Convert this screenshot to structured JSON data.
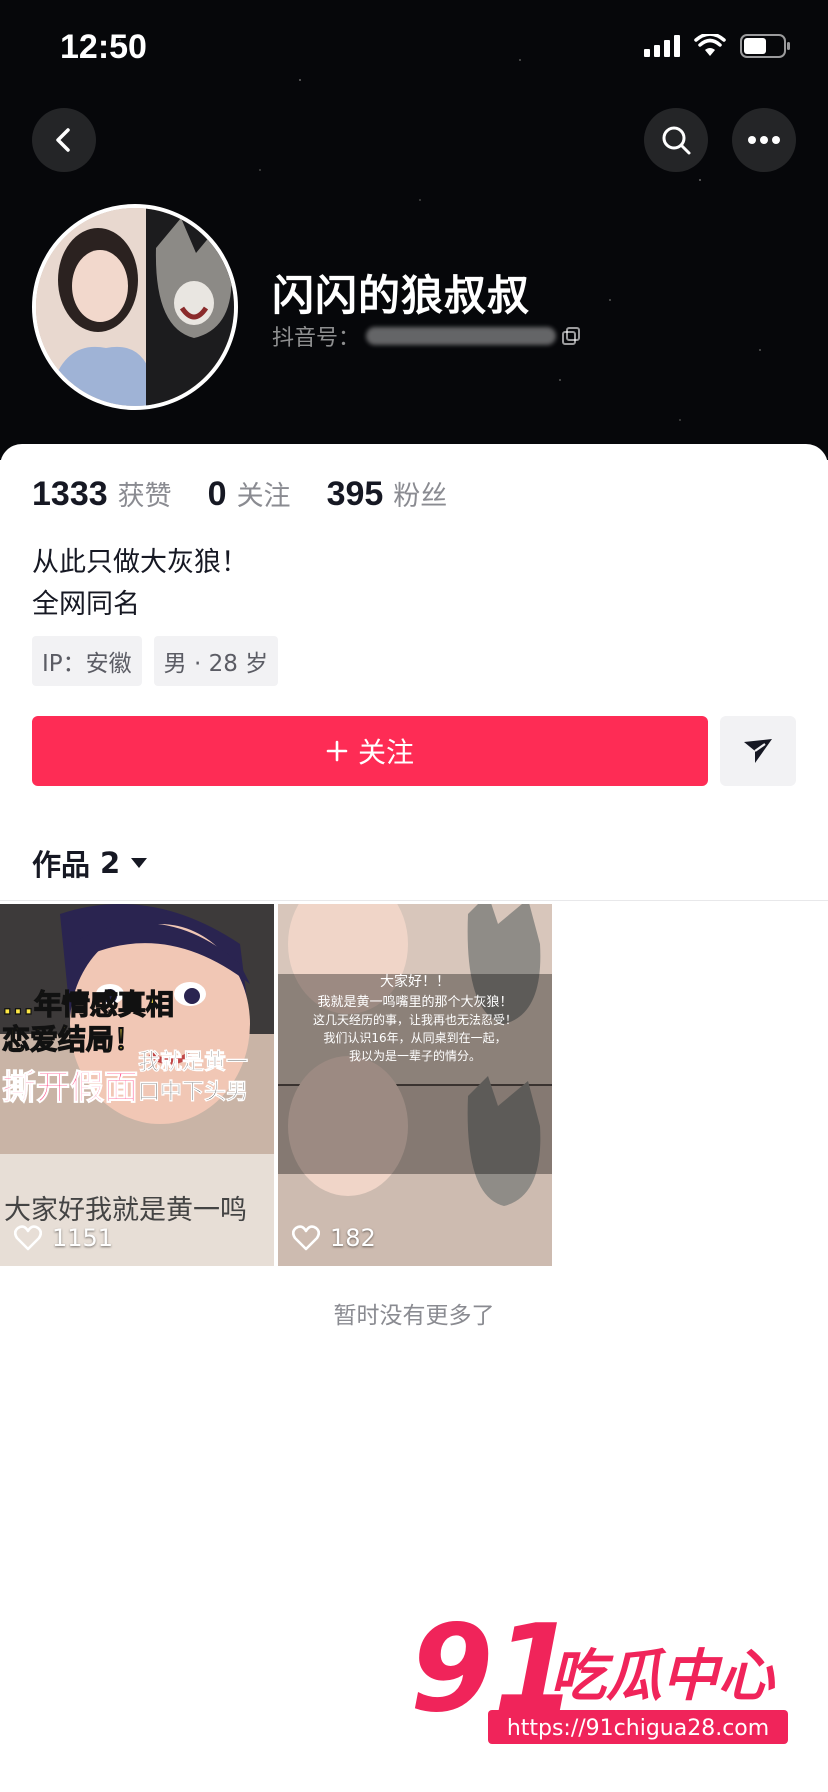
{
  "status_bar": {
    "time": "12:50"
  },
  "profile": {
    "nickname": "闪闪的狼叔叔",
    "id_label": "抖音号："
  },
  "stats": [
    {
      "value": "1333",
      "label": "获赞"
    },
    {
      "value": "0",
      "label": "关注"
    },
    {
      "value": "395",
      "label": "粉丝"
    }
  ],
  "bio": {
    "line1": "从此只做大灰狼！",
    "line2": "全网同名"
  },
  "tags": [
    "IP：安徽",
    "男 · 28 岁"
  ],
  "actions": {
    "follow_label": "关注"
  },
  "works": {
    "tab_label": "作品",
    "count": "2",
    "items": [
      {
        "likes": "1151",
        "caption_lines": [
          "...年情感真相",
          "恋爱结局！",
          "撕开假面",
          "我就是黄一",
          "口中下头男",
          "大家好我就是黄一鸣"
        ]
      },
      {
        "likes": "182",
        "caption_lines": [
          "大家好！！",
          "我就是黄一鸣嘴里的那个大灰狼！",
          "这几天经历的事，让我再也无法忍受！",
          "我们认识16年，从同桌到在一起，",
          "我以为是一辈子的情分。"
        ]
      }
    ],
    "no_more": "暂时没有更多了"
  },
  "watermark": {
    "brand": "91",
    "text": "吃瓜中心",
    "url": "https://91chigua28.com"
  },
  "colors": {
    "accent": "#fe2c55",
    "header_bg": "#06070a"
  },
  "icons": [
    "back-icon",
    "search-icon",
    "more-icon",
    "copy-icon",
    "plus-icon",
    "share-icon",
    "caret-down-icon",
    "heart-icon"
  ]
}
